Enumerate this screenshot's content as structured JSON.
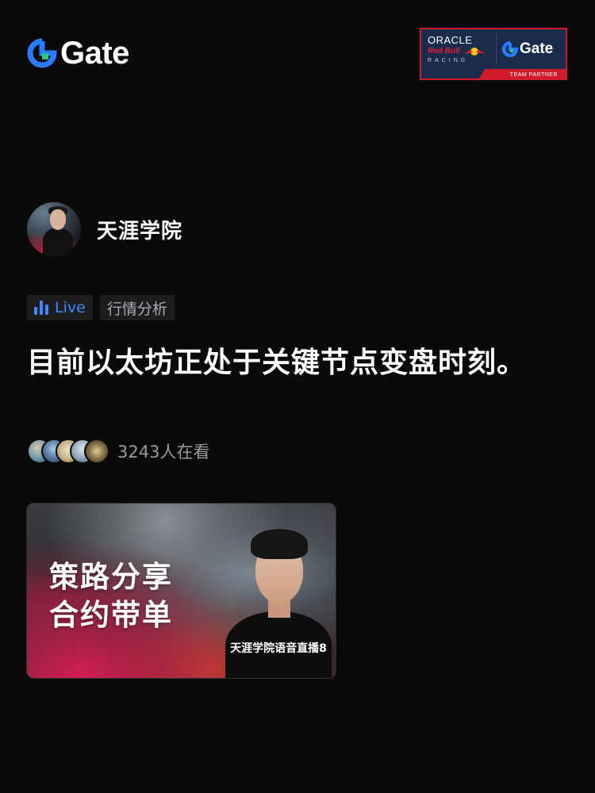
{
  "brand": {
    "name": "Gate",
    "accent": "#2a7bff",
    "accent_secondary": "#2ec97a"
  },
  "partner_badge": {
    "oracle": "ORACLE",
    "red_bull": "Red Bull",
    "racing": "RACING",
    "gate": "Gate",
    "tagline": "TEAM PARTNER",
    "background": "#1b2b4b",
    "border": "#d01c2a"
  },
  "host": {
    "name": "天涯学院",
    "avatar_caption": "天涯学院语音直播8"
  },
  "tags": {
    "live_label": "Live",
    "topic_label": "行情分析",
    "live_color": "#3f86ff"
  },
  "title": "目前以太坊正处于关键节点变盘时刻。",
  "viewers": {
    "count_text": "3243人在看",
    "avatars": [
      {
        "color": "#6a9bb0"
      },
      {
        "color": "#4c6f9a"
      },
      {
        "color": "#c7b38a"
      },
      {
        "color": "#8ea9b9"
      },
      {
        "color": "#7a6640"
      }
    ]
  },
  "cover": {
    "line1": "策路分享",
    "line2": "合约带单",
    "caption": "天涯学院语音直播8"
  }
}
